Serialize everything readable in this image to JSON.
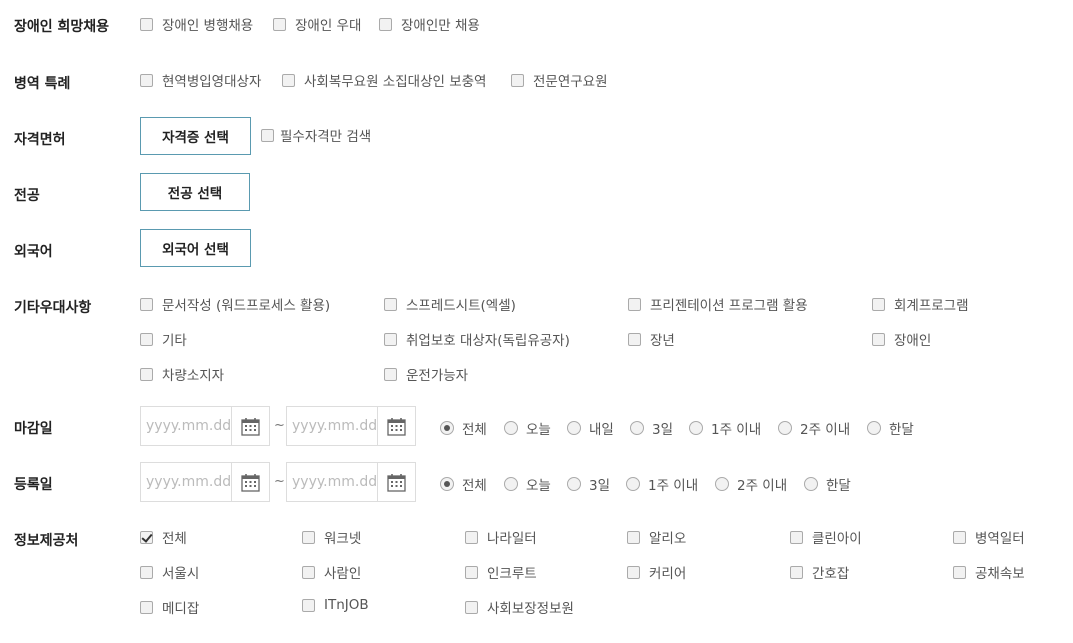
{
  "disability": {
    "label": "장애인 희망채용",
    "options": [
      "장애인 병행채용",
      "장애인 우대",
      "장애인만 채용"
    ]
  },
  "military": {
    "label": "병역 특례",
    "options": [
      "현역병입영대상자",
      "사회복무요원 소집대상인 보충역",
      "전문연구요원"
    ]
  },
  "license": {
    "label": "자격면허",
    "button": "자격증 선택",
    "required_only": "필수자격만 검색"
  },
  "major": {
    "label": "전공",
    "button": "전공 선택"
  },
  "language": {
    "label": "외국어",
    "button": "외국어 선택"
  },
  "etc": {
    "label": "기타우대사항",
    "options": [
      "문서작성 (워드프로세스 활용)",
      "스프레드시트(엑셀)",
      "프리젠테이션 프로그램 활용",
      "회계프로그램",
      "기타",
      "취업보호 대상자(독립유공자)",
      "장년",
      "장애인",
      "차량소지자",
      "운전가능자"
    ]
  },
  "deadline": {
    "label": "마감일",
    "placeholder": "yyyy.mm.dd",
    "tilde": "~",
    "options": [
      "전체",
      "오늘",
      "내일",
      "3일",
      "1주 이내",
      "2주 이내",
      "한달"
    ],
    "selected": "전체"
  },
  "registered": {
    "label": "등록일",
    "placeholder": "yyyy.mm.dd",
    "tilde": "~",
    "options": [
      "전체",
      "오늘",
      "3일",
      "1주 이내",
      "2주 이내",
      "한달"
    ],
    "selected": "전체"
  },
  "source": {
    "label": "정보제공처",
    "options": [
      "전체",
      "워크넷",
      "나라일터",
      "알리오",
      "클린아이",
      "병역일터",
      "서울시",
      "사람인",
      "인크루트",
      "커리어",
      "간호잡",
      "공채속보",
      "메디잡",
      "ITnJOB",
      "사회보장정보원"
    ],
    "checked": [
      "전체"
    ]
  }
}
